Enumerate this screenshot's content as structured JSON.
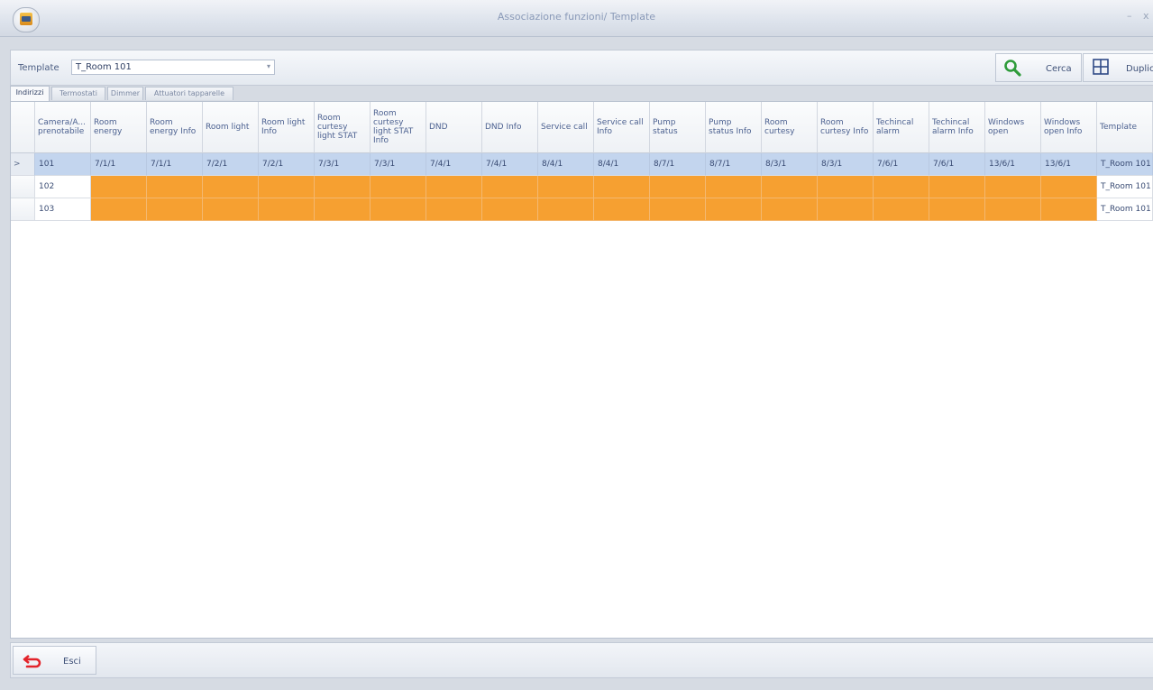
{
  "window": {
    "title": "Associazione funzioni/ Template",
    "minimize_glyph": "–",
    "close_glyph": "x"
  },
  "toolbar": {
    "template_label": "Template",
    "template_value": "T_Room 101",
    "search_label": "Cerca",
    "duplicate_label": "Duplica"
  },
  "tabs": [
    "Indirizzi",
    "Termostati",
    "Dimmer",
    "Attuatori tapparelle"
  ],
  "grid": {
    "columns": [
      "Camera/A... prenotabile",
      "Room energy",
      "Room energy Info",
      "Room light",
      "Room light Info",
      "Room curtesy light STAT",
      "Room curtesy light STAT Info",
      "DND",
      "DND Info",
      "Service call",
      "Service call Info",
      "Pump status",
      "Pump status Info",
      "Room curtesy",
      "Room curtesy Info",
      "Techincal alarm",
      "Techincal alarm Info",
      "Windows open",
      "Windows open Info",
      "Template"
    ],
    "rows": [
      {
        "selected": true,
        "indicator": ">",
        "cells": [
          "101",
          "7/1/1",
          "7/1/1",
          "7/2/1",
          "7/2/1",
          "7/3/1",
          "7/3/1",
          "7/4/1",
          "7/4/1",
          "8/4/1",
          "8/4/1",
          "8/7/1",
          "8/7/1",
          "8/3/1",
          "8/3/1",
          "7/6/1",
          "7/6/1",
          "13/6/1",
          "13/6/1",
          "T_Room 101"
        ]
      },
      {
        "selected": false,
        "indicator": "",
        "cells": [
          "102",
          "",
          "",
          "",
          "",
          "",
          "",
          "",
          "",
          "",
          "",
          "",
          "",
          "",
          "",
          "",
          "",
          "",
          "",
          "T_Room 101"
        ]
      },
      {
        "selected": false,
        "indicator": "",
        "cells": [
          "103",
          "",
          "",
          "",
          "",
          "",
          "",
          "",
          "",
          "",
          "",
          "",
          "",
          "",
          "",
          "",
          "",
          "",
          "",
          "T_Room 101"
        ]
      }
    ]
  },
  "footer": {
    "exit_label": "Esci"
  },
  "colors": {
    "missing_cell": "#f6a031",
    "selected_row": "#c3d5ee",
    "header_text": "#4c6190",
    "search_icon": "#2e9b3a",
    "exit_icon": "#e3242b"
  }
}
